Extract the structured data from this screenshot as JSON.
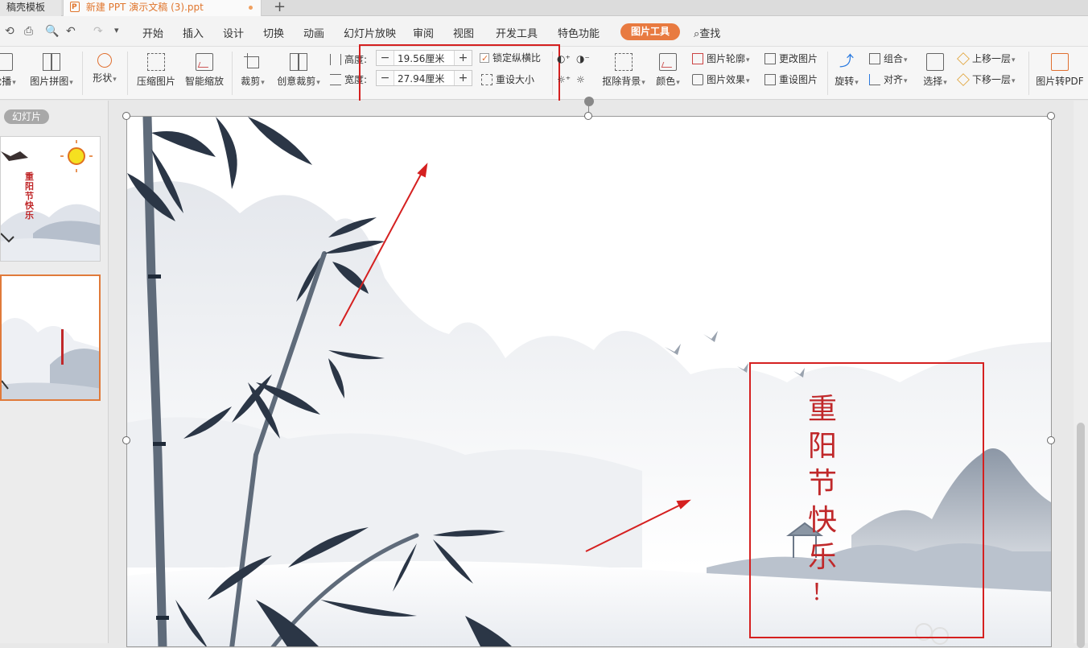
{
  "tabs": {
    "inactive_label": "稿壳模板",
    "active_label": "新建 PPT 演示文稿 (3).ppt",
    "new_tab": "+"
  },
  "menu": {
    "items": [
      "开始",
      "插入",
      "设计",
      "切换",
      "动画",
      "幻灯片放映",
      "审阅",
      "视图",
      "开发工具",
      "特色功能"
    ],
    "active": "图片工具",
    "search": "查找"
  },
  "ribbon": {
    "carousel": "轮播",
    "collage": "图片拼图",
    "shape": "形状",
    "compress": "压缩图片",
    "smart_zoom": "智能缩放",
    "crop": "裁剪",
    "creative_crop": "创意裁剪",
    "height_label": "高度:",
    "height_value": "19.56厘米",
    "width_label": "宽度:",
    "width_value": "27.94厘米",
    "lock_ratio": "锁定纵横比",
    "lock_ratio_checked": true,
    "reset_size": "重设大小",
    "remove_bg": "抠除背景",
    "color": "颜色",
    "outline": "图片轮廓",
    "effect": "图片效果",
    "change_pic": "更改图片",
    "reset_pic": "重设图片",
    "rotate": "旋转",
    "group": "组合",
    "align": "对齐",
    "select": "选择",
    "bring_forward": "上移一层",
    "send_backward": "下移一层",
    "to_pdf": "图片转PDF"
  },
  "panel": {
    "title": "幻灯片",
    "thumb1_text": "重阳节快乐"
  },
  "slide": {
    "text_chars": [
      "重",
      "阳",
      "节",
      "快",
      "乐",
      "！"
    ]
  },
  "colors": {
    "accent": "#e87a40",
    "annotation_red": "#d52020",
    "festival_text": "#c0282a"
  }
}
